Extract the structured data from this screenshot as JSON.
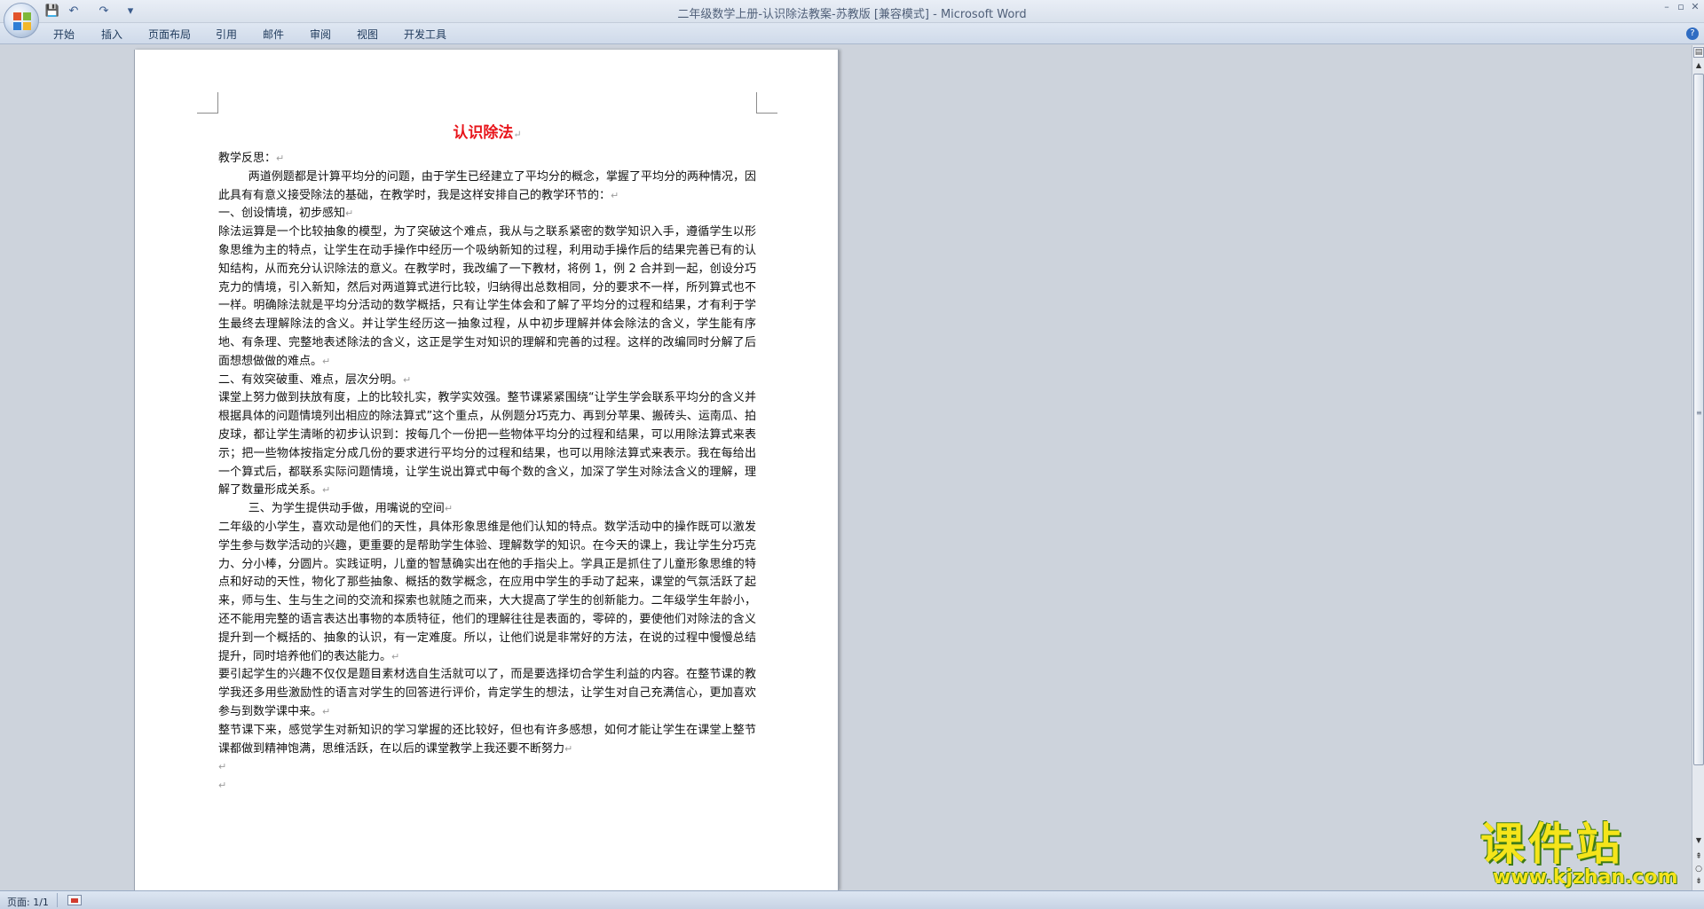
{
  "window": {
    "title": "二年级数学上册-认识除法教案-苏教版 [兼容模式] - Microsoft Word",
    "controls": [
      "–",
      "▫",
      "✕"
    ]
  },
  "quick_access": {
    "save": "💾",
    "undo": "↶",
    "redo": "↷",
    "more": "▾"
  },
  "ribbon": {
    "tabs": [
      "开始",
      "插入",
      "页面布局",
      "引用",
      "邮件",
      "审阅",
      "视图",
      "开发工具"
    ],
    "help": "?"
  },
  "document": {
    "heading": "认识除法",
    "paragraph_mark": "↵",
    "paragraphs": [
      {
        "text": "教学反思：",
        "indent": false
      },
      {
        "text": "两道例题都是计算平均分的问题，由于学生已经建立了平均分的概念，掌握了平均分的两种情况，因此具有有意义接受除法的基础，在教学时，我是这样安排自己的教学环节的：",
        "indent": true
      },
      {
        "text": "一、创设情境，初步感知",
        "indent": false
      },
      {
        "text": "除法运算是一个比较抽象的模型，为了突破这个难点，我从与之联系紧密的数学知识入手，遵循学生以形象思维为主的特点，让学生在动手操作中经历一个吸纳新知的过程，利用动手操作后的结果完善已有的认知结构，从而充分认识除法的意义。在教学时，我改编了一下教材，将例 1，例 2 合并到一起，创设分巧克力的情境，引入新知，然后对两道算式进行比较，归纳得出总数相同，分的要求不一样，所列算式也不一样。明确除法就是平均分活动的数学概括，只有让学生体会和了解了平均分的过程和结果，才有利于学生最终去理解除法的含义。并让学生经历这一抽象过程，从中初步理解并体会除法的含义，学生能有序地、有条理、完整地表述除法的含义，这正是学生对知识的理解和完善的过程。这样的改编同时分解了后面想想做做的难点。",
        "indent": false
      },
      {
        "text": "二、有效突破重、难点，层次分明。",
        "indent": false
      },
      {
        "text": "课堂上努力做到扶放有度，上的比较扎实，教学实效强。整节课紧紧围绕“让学生学会联系平均分的含义并根据具体的问题情境列出相应的除法算式”这个重点，从例题分巧克力、再到分苹果、搬砖头、运南瓜、拍皮球，都让学生清晰的初步认识到：按每几个一份把一些物体平均分的过程和结果，可以用除法算式来表示；把一些物体按指定分成几份的要求进行平均分的过程和结果，也可以用除法算式来表示。我在每给出一个算式后，都联系实际问题情境，让学生说出算式中每个数的含义，加深了学生对除法含义的理解，理解了数量形成关系。",
        "indent": false
      },
      {
        "text": "三、为学生提供动手做，用嘴说的空间",
        "indent": true
      },
      {
        "text": "二年级的小学生，喜欢动是他们的天性，具体形象思维是他们认知的特点。数学活动中的操作既可以激发学生参与数学活动的兴趣，更重要的是帮助学生体验、理解数学的知识。在今天的课上，我让学生分巧克力、分小棒，分圆片。实践证明，儿童的智慧确实出在他的手指尖上。学具正是抓住了儿童形象思维的特点和好动的天性，物化了那些抽象、概括的数学概念，在应用中学生的手动了起来，课堂的气氛活跃了起来，师与生、生与生之间的交流和探索也就随之而来，大大提高了学生的创新能力。二年级学生年龄小，还不能用完整的语言表达出事物的本质特征，他们的理解往往是表面的，零碎的，要使他们对除法的含义提升到一个概括的、抽象的认识，有一定难度。所以，让他们说是非常好的方法，在说的过程中慢慢总结提升，同时培养他们的表达能力。",
        "indent": false
      },
      {
        "text": "要引起学生的兴趣不仅仅是题目素材选自生活就可以了，而是要选择切合学生利益的内容。在整节课的教学我还多用些激励性的语言对学生的回答进行评价，肯定学生的想法，让学生对自己充满信心，更加喜欢参与到数学课中来。",
        "indent": false
      },
      {
        "text": "整节课下来，感觉学生对新知识的学习掌握的还比较好，但也有许多感想，如何才能让学生在课堂上整节课都做到精神饱满，思维活跃，在以后的课堂教学上我还要不断努力",
        "indent": false
      },
      {
        "text": "",
        "indent": false
      },
      {
        "text": "",
        "indent": false
      }
    ]
  },
  "status_bar": {
    "page": "页面: 1/1"
  },
  "watermark": {
    "main": "课件站",
    "url": "www.kjzhan.com"
  },
  "colors": {
    "heading": "#e8141a",
    "watermark_fill": "#f5e41a",
    "watermark_outline": "#3c7a16"
  }
}
